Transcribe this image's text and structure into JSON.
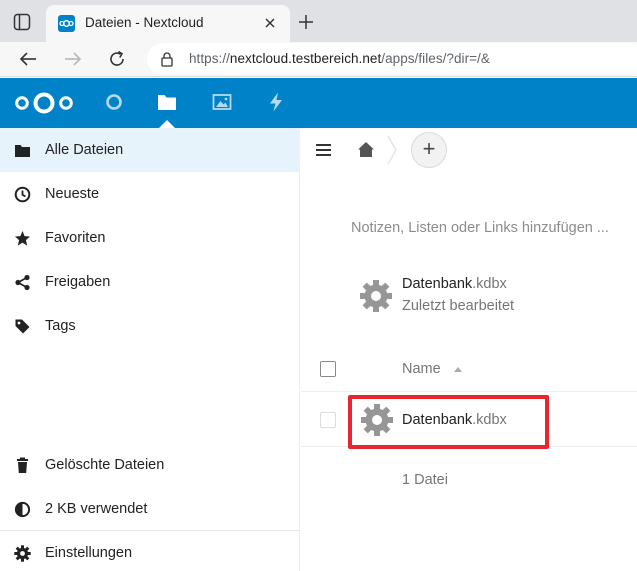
{
  "browser": {
    "tab_title": "Dateien - Nextcloud",
    "url_prefix": "https://",
    "url_host": "nextcloud.testbereich.net",
    "url_path": "/apps/files/?dir=/&"
  },
  "header": {
    "apps": [
      "dashboard-icon",
      "files-icon",
      "photos-icon",
      "activity-icon"
    ],
    "accent_color": "#0082c9"
  },
  "sidebar": {
    "items": [
      {
        "label": "Alle Dateien",
        "icon": "folder-icon",
        "active": true
      },
      {
        "label": "Neueste",
        "icon": "clock-icon"
      },
      {
        "label": "Favoriten",
        "icon": "star-icon"
      },
      {
        "label": "Freigaben",
        "icon": "share-icon"
      },
      {
        "label": "Tags",
        "icon": "tag-icon"
      }
    ],
    "bottom_items": [
      {
        "label": "Gelöschte Dateien",
        "icon": "trash-icon"
      },
      {
        "label": "2 KB verwendet",
        "icon": "quota-icon"
      },
      {
        "label": "Einstellungen",
        "icon": "gear-icon"
      }
    ]
  },
  "main": {
    "add_symbol": "+",
    "notes_placeholder": "Notizen, Listen oder Links hinzufügen ...",
    "recent": {
      "file_base": "Datenbank",
      "file_ext": ".kdbx",
      "subtitle": "Zuletzt bearbeitet"
    },
    "table": {
      "column_name": "Name",
      "rows": [
        {
          "base": "Datenbank",
          "ext": ".kdbx"
        }
      ],
      "summary": "1 Datei"
    },
    "highlight_color": "#e8262d"
  }
}
